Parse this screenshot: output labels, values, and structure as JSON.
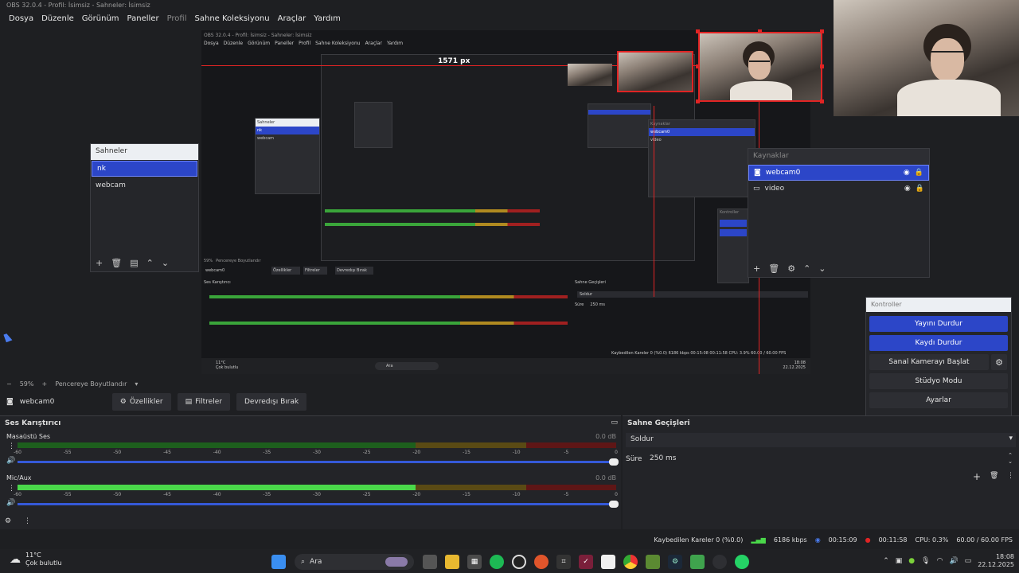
{
  "window": {
    "title": "OBS 32.0.4 - Profil: İsimsiz - Sahneler: İsimsiz"
  },
  "menu": [
    "Dosya",
    "Düzenle",
    "Görünüm",
    "Paneller",
    "Profil",
    "Sahne Koleksiyonu",
    "Araçlar",
    "Yardım"
  ],
  "preview": {
    "inner_title": "OBS 32.0.4 - Profil: İsimsiz - Sahneler: İsimsiz",
    "inner_menu": [
      "Dosya",
      "Düzenle",
      "Görünüm",
      "Paneller",
      "Profil",
      "Sahne Koleksiyonu",
      "Araçlar",
      "Yardım"
    ],
    "width_label": "1571 px",
    "inner_labels": {
      "scenes_header": "Sahneler",
      "scene_nk": "nk",
      "scene_webcam": "webcam",
      "sources_header": "Kaynaklar",
      "source_webcam": "webcam0",
      "source_video": "video",
      "controls_header": "Kontroller",
      "props": "Özellikler",
      "filters": "Filtreler",
      "deactivate": "Devredışı Bırak",
      "mixer": "Ses Karıştırıcı",
      "transitions": "Sahne Geçişleri",
      "fade": "Soldur",
      "duration": "Süre",
      "duration_value": "250 ms",
      "zoom": "59%",
      "fit": "Pencereye Boyutlandır",
      "source": "webcam0",
      "search": "Ara",
      "weather_temp": "11°C",
      "weather_desc": "Çok bulutlu",
      "status": "Kaybedilen Kareler 0 (%0.0)   6186 kbps   00:15:08   00:11:58   CPU: 3.9%   60.00 / 60.00 FPS",
      "clock_time": "18:08",
      "clock_date": "22.12.2025"
    }
  },
  "scenes_panel": {
    "header": "Sahneler",
    "items": [
      {
        "label": "nk",
        "selected": true
      },
      {
        "label": "webcam",
        "selected": false
      }
    ]
  },
  "sources_panel": {
    "header": "Kaynaklar",
    "items": [
      {
        "label": "webcam0",
        "icon": "camera-icon",
        "selected": true
      },
      {
        "label": "video",
        "icon": "monitor-icon",
        "selected": false
      }
    ]
  },
  "controls": {
    "header": "Kontroller",
    "buttons": [
      {
        "label": "Yayını Durdur",
        "active": true
      },
      {
        "label": "Kaydı Durdur",
        "active": true
      },
      {
        "label": "Sanal Kamerayı Başlat",
        "active": false
      },
      {
        "label": "Stüdyo Modu",
        "active": false
      },
      {
        "label": "Ayarlar",
        "active": false
      }
    ]
  },
  "zoom": {
    "value": "59%",
    "fit_label": "Pencereye Boyutlandır"
  },
  "source_toolbar": {
    "source_name": "webcam0",
    "properties": "Özellikler",
    "filters": "Filtreler",
    "deactivate": "Devredışı Bırak"
  },
  "mixer": {
    "title": "Ses Karıştırıcı",
    "ticks": [
      "-60",
      "-55",
      "-50",
      "-45",
      "-40",
      "-35",
      "-30",
      "-25",
      "-20",
      "-15",
      "-10",
      "-5",
      "0"
    ],
    "tracks": [
      {
        "name": "Masaüstü Ses",
        "db": "0.0 dB",
        "level": 0
      },
      {
        "name": "Mic/Aux",
        "db": "0.0 dB",
        "level": 0.665
      }
    ]
  },
  "transitions": {
    "title": "Sahne Geçişleri",
    "selected": "Soldur",
    "duration_label": "Süre",
    "duration_value": "250 ms"
  },
  "status": {
    "dropped": "Kaybedilen Kareler 0 (%0.0)",
    "bitrate": "6186 kbps",
    "stream_time": "00:15:09",
    "rec_time": "00:11:58",
    "cpu": "CPU: 0.3%",
    "fps": "60.00 / 60.00 FPS"
  },
  "taskbar": {
    "weather_temp": "11°C",
    "weather_desc": "Çok bulutlu",
    "search": "Ara",
    "time": "18:08",
    "date": "22.12.2025"
  },
  "colors": {
    "accent": "#2c46c8",
    "selection_border": "#e02424",
    "meter_green": "#4ad84a"
  }
}
